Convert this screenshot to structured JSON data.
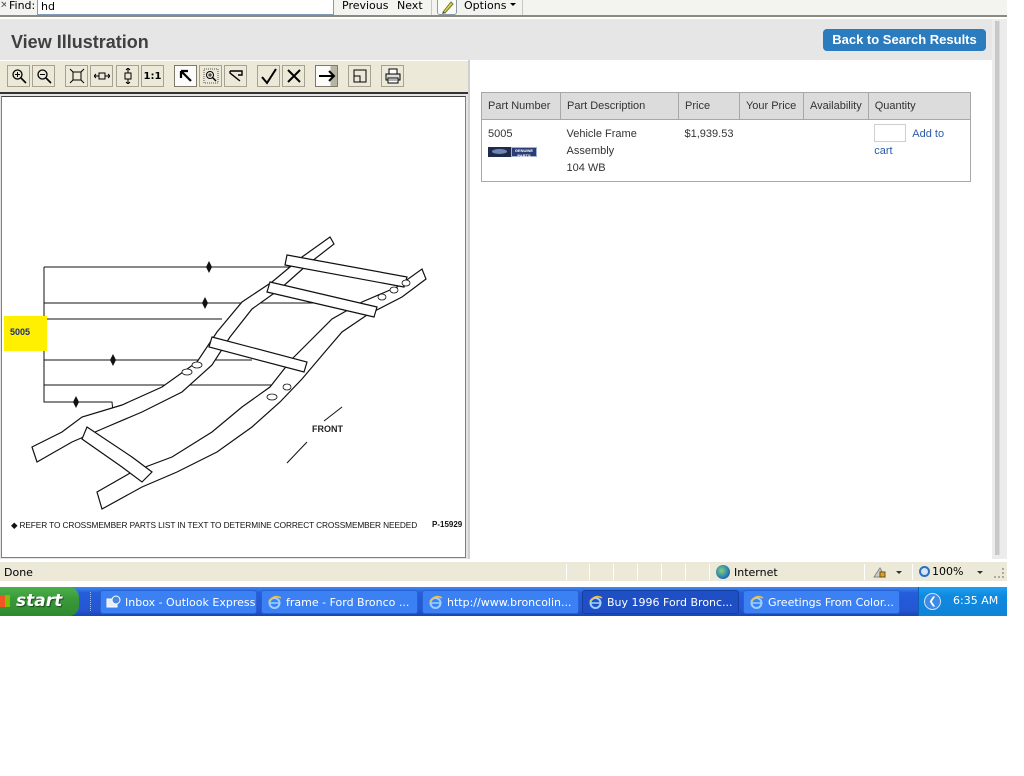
{
  "find_bar": {
    "label": "Find:",
    "value": "hd",
    "previous_label": "Previous",
    "next_label": "Next",
    "options_label": "Options"
  },
  "header": {
    "title": "View Illustration",
    "back_button": "Back to Search Results"
  },
  "viewer": {
    "toolbar": [
      {
        "name": "zoom-in",
        "glyph": "⊕"
      },
      {
        "name": "zoom-out",
        "glyph": "⊖"
      },
      {
        "name": "fit-all",
        "glyph": "⛶"
      },
      {
        "name": "fit-width",
        "glyph": "↔"
      },
      {
        "name": "fit-height",
        "glyph": "↕"
      },
      {
        "name": "actual-size",
        "glyph": "1:1"
      },
      {
        "name": "select-pointer",
        "glyph": "↖"
      },
      {
        "name": "zoom-window",
        "glyph": "⊡"
      },
      {
        "name": "select-area",
        "glyph": "◹"
      },
      {
        "name": "check",
        "glyph": "✓"
      },
      {
        "name": "clear",
        "glyph": "✕"
      },
      {
        "name": "next-callout",
        "glyph": "→"
      },
      {
        "name": "thumbnail",
        "glyph": "◱"
      },
      {
        "name": "print",
        "glyph": "⎙"
      }
    ],
    "callout_label": "5005",
    "front_label": "FRONT",
    "footnote": "◆ REFER TO CROSSMEMBER PARTS LIST IN TEXT TO DETERMINE CORRECT CROSSMEMBER NEEDED",
    "illustration_id": "P-15929"
  },
  "parts_table": {
    "columns": [
      "Part Number",
      "Part Description",
      "Price",
      "Your Price",
      "Availability",
      "Quantity"
    ],
    "rows": [
      {
        "part_number": "5005",
        "brand_badge": "Ford Genuine Parts",
        "description_lines": [
          "Vehicle Frame",
          "Assembly",
          "104 WB"
        ],
        "price": "$1,939.53",
        "your_price": "",
        "availability": "",
        "quantity": "",
        "add_to_cart": "Add to cart"
      }
    ]
  },
  "status_bar": {
    "status": "Done",
    "zone": "Internet",
    "zoom": "100%"
  },
  "taskbar": {
    "start_label": "start",
    "tasks": [
      {
        "label": "Inbox - Outlook Express",
        "icon": "outlook-icon",
        "active": false
      },
      {
        "label": "frame - Ford Bronco ...",
        "icon": "ie-icon",
        "active": false
      },
      {
        "label": "http://www.broncolin...",
        "icon": "ie-icon",
        "active": false
      },
      {
        "label": "Buy 1996 Ford Bronc...",
        "icon": "ie-icon",
        "active": true
      },
      {
        "label": "Greetings From Color...",
        "icon": "ie-icon",
        "active": false
      }
    ],
    "clock": "6:35 AM"
  }
}
